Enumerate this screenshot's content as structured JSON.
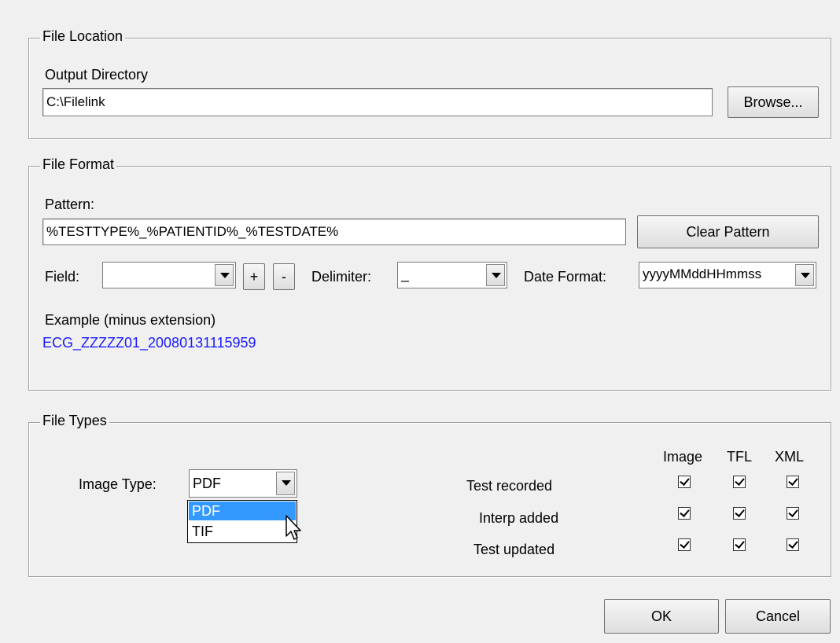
{
  "file_location": {
    "legend": "File Location",
    "output_dir_label": "Output Directory",
    "output_dir_value": "C:\\Filelink",
    "browse_label": "Browse..."
  },
  "file_format": {
    "legend": "File Format",
    "pattern_label": "Pattern:",
    "pattern_value": "%TESTTYPE%_%PATIENTID%_%TESTDATE%",
    "clear_pattern_label": "Clear Pattern",
    "field_label": "Field:",
    "field_value": "",
    "plus_label": "+",
    "minus_label": "-",
    "delimiter_label": "Delimiter:",
    "delimiter_value": "_",
    "date_format_label": "Date Format:",
    "date_format_value": "yyyyMMddHHmmss",
    "example_label": "Example (minus extension)",
    "example_value": "ECG_ZZZZZ01_20080131115959",
    "example_color": "#1a1aff"
  },
  "file_types": {
    "legend": "File Types",
    "image_type_label": "Image Type:",
    "image_type_value": "PDF",
    "dropdown_options": [
      "PDF",
      "TIF"
    ],
    "dropdown_highlighted": "PDF",
    "column_headers": [
      "Image",
      "TFL",
      "XML"
    ],
    "rows": [
      {
        "label": "Test recorded",
        "checks": [
          true,
          true,
          true
        ]
      },
      {
        "label": "Interp added",
        "checks": [
          true,
          true,
          true
        ]
      },
      {
        "label": "Test updated",
        "checks": [
          true,
          true,
          true
        ]
      }
    ]
  },
  "footer": {
    "ok_label": "OK",
    "cancel_label": "Cancel"
  },
  "colors": {
    "highlight": "#3399ff",
    "dialog_bg": "#f0f0f0"
  }
}
